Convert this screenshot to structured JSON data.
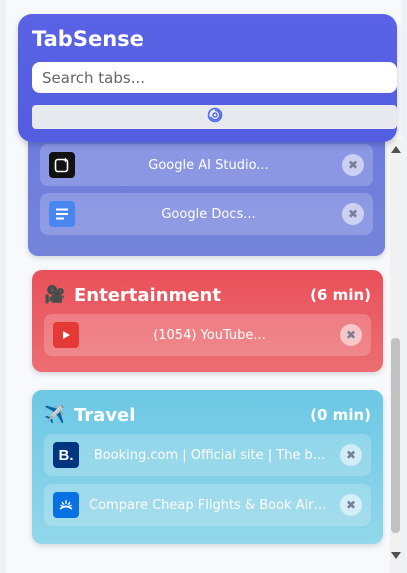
{
  "header": {
    "title": "TabSense",
    "search_placeholder": "Search tabs..."
  },
  "groups": [
    {
      "name": "",
      "time": "",
      "color": "#6e7be0",
      "tabs": [
        {
          "title": "Google AI Studio...",
          "icon": "ai-studio-icon"
        },
        {
          "title": "Google Docs...",
          "icon": "google-docs-icon"
        }
      ]
    },
    {
      "name": "Entertainment",
      "emoji": "🎥",
      "time": "(6 min)",
      "color": "#e9505a",
      "tabs": [
        {
          "title": "(1054) YouTube...",
          "icon": "youtube-icon"
        }
      ]
    },
    {
      "name": "Travel",
      "emoji": "✈️",
      "time": "(0 min)",
      "color": "#6cc8e4",
      "tabs": [
        {
          "title": "Booking.com | Official site | The b...",
          "icon": "booking-icon"
        },
        {
          "title": "Compare Cheap Flights & Book Airlin...",
          "icon": "skyscanner-icon"
        }
      ]
    }
  ],
  "close_glyph": "✖"
}
